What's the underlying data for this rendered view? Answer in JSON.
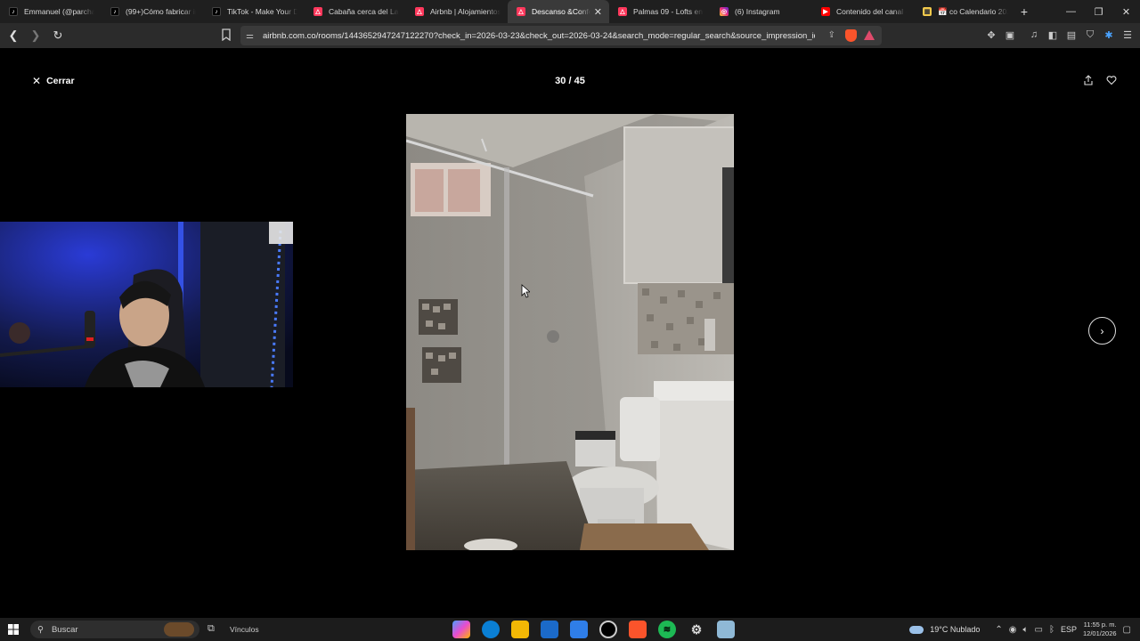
{
  "browser": {
    "tabs": [
      {
        "title": "Emmanuel (@parchate",
        "favicon": "tiktok-icon",
        "active": false
      },
      {
        "title": "(99+)Cómo fabricar in",
        "favicon": "tiktok-icon",
        "active": false
      },
      {
        "title": "TikTok - Make Your Da",
        "favicon": "tiktok-icon",
        "active": false
      },
      {
        "title": "Cabaña cerca del Lago",
        "favicon": "airbnb-icon",
        "active": false
      },
      {
        "title": "Airbnb | Alojamientos",
        "favicon": "airbnb-icon",
        "active": false
      },
      {
        "title": "Descanso &Confo",
        "favicon": "airbnb-icon",
        "active": true
      },
      {
        "title": "Palmas 09 - Lofts en al",
        "favicon": "airbnb-icon",
        "active": false
      },
      {
        "title": "(6) Instagram",
        "favicon": "instagram-icon",
        "active": false
      },
      {
        "title": "Contenido del canal -",
        "favicon": "youtube-icon",
        "active": false
      },
      {
        "title": "📅 co Calendario 2026",
        "favicon": "calendar-icon",
        "active": false
      }
    ],
    "url": "airbnb.com.co/rooms/1443652947247122270?check_in=2026-03-23&check_out=2026-03-24&search_mode=regular_search&source_impression_id=..."
  },
  "viewer": {
    "close_label": "Cerrar",
    "counter": "30 / 45"
  },
  "taskbar": {
    "search_placeholder": "Buscar",
    "vinculos": "Vínculos",
    "weather": "19°C  Nublado",
    "lang": "ESP",
    "time": "11:55 p. m.",
    "date": "12/01/2026"
  }
}
